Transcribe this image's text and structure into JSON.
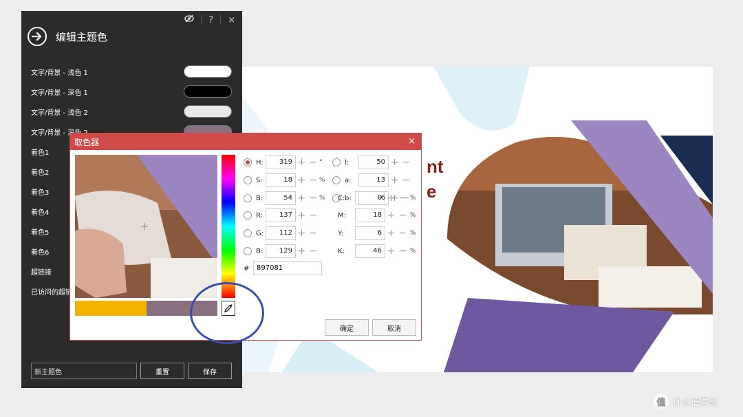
{
  "panel": {
    "title": "编辑主题色",
    "icons": [
      "eye-hidden-icon",
      "help-icon",
      "close-icon"
    ],
    "help_glyph": "?",
    "close_glyph": "×",
    "rows": [
      {
        "label": "文字/背景 - 浅色 1",
        "color": "#ffffff"
      },
      {
        "label": "文字/背景 - 深色 1",
        "color": "#000000"
      },
      {
        "label": "文字/背景 - 浅色 2",
        "color": "#e8e8e8"
      },
      {
        "label": "文字/背景 - 深色 2",
        "color": "#897081"
      },
      {
        "label": "着色1",
        "color": "#7b5ca0"
      },
      {
        "label": "着色2",
        "color": "#5b6aa8"
      },
      {
        "label": "着色3",
        "color": "#4aa0c0"
      },
      {
        "label": "着色4",
        "color": "#6aa84f"
      },
      {
        "label": "着色5",
        "color": "#e6a23c"
      },
      {
        "label": "着色6",
        "color": "#d04a4a"
      },
      {
        "label": "超链接",
        "color": "#3c78d8"
      },
      {
        "label": "已访问的超链",
        "color": "#8e44ad"
      }
    ],
    "name_input": "新主题色",
    "reset_label": "重置",
    "save_label": "保存"
  },
  "dialog": {
    "title": "取色器",
    "close_glyph": "×",
    "old_color": "#f5b300",
    "new_color": "#897081",
    "hsb_fields": [
      {
        "label": "H:",
        "value": "319",
        "unit": "°",
        "checked": true
      },
      {
        "label": "S:",
        "value": "18",
        "unit": "%",
        "checked": false
      },
      {
        "label": "B:",
        "value": "54",
        "unit": "%",
        "checked": false
      },
      {
        "label": "R:",
        "value": "137",
        "unit": "",
        "checked": false
      },
      {
        "label": "G:",
        "value": "112",
        "unit": "",
        "checked": false
      },
      {
        "label": "B:",
        "value": "129",
        "unit": "",
        "checked": false
      }
    ],
    "lab_fields": [
      {
        "label": "l:",
        "value": "50"
      },
      {
        "label": "a:",
        "value": "13"
      },
      {
        "label": "b:",
        "value": "-6"
      }
    ],
    "cmyk_fields": [
      {
        "label": "C:",
        "value": "0",
        "unit": "%"
      },
      {
        "label": "M:",
        "value": "18",
        "unit": "%"
      },
      {
        "label": "Y:",
        "value": "6",
        "unit": "%"
      },
      {
        "label": "K:",
        "value": "46",
        "unit": "%"
      }
    ],
    "hex_prefix": "#",
    "hex_value": "897081",
    "ok_label": "确定",
    "cancel_label": "取消"
  },
  "slide": {
    "text_line1": "nt",
    "text_line2": "e"
  },
  "watermark": {
    "logo": "值",
    "text": "什么值得买"
  }
}
